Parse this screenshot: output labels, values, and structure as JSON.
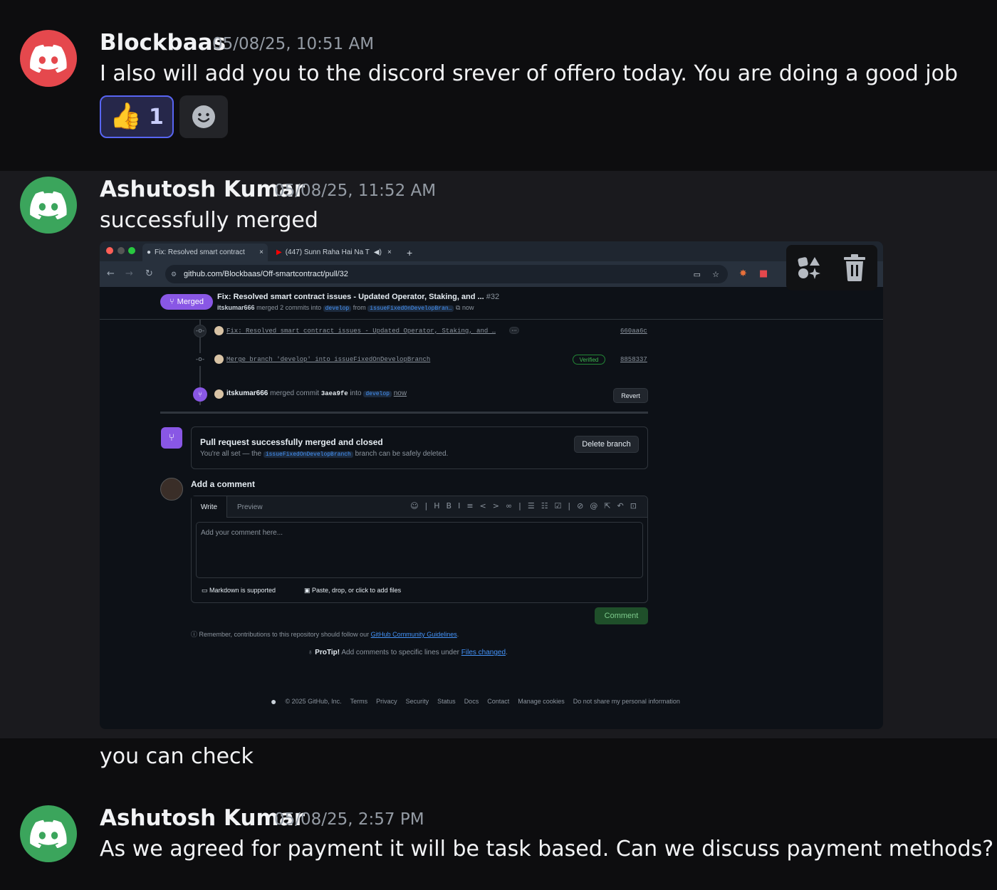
{
  "messages": [
    {
      "author": "Blockbaas",
      "timestamp": "05/08/25, 10:51 AM",
      "text": "I also will add you to the discord srever of offero today. You are doing a good job",
      "reactions": [
        {
          "emoji": "👍",
          "count": "1"
        }
      ]
    },
    {
      "author": "Ashutosh Kumar",
      "timestamp": "05/08/25, 11:52 AM",
      "text": "successfully merged",
      "followup": "you can check"
    },
    {
      "author": "Ashutosh Kumar",
      "timestamp": "05/08/25, 2:57 PM",
      "text": "As we agreed for payment it will be task based. Can we discuss payment methods?"
    }
  ],
  "avatar_colors": {
    "blockbaas": "#e5484d",
    "ashutosh": "#3ba55c"
  },
  "screenshot": {
    "tabs": [
      "Fix: Resolved smart contract",
      "(447) Sunn Raha Hai Na T"
    ],
    "url": "github.com/Blockbaas/Off-smartcontract/pull/32",
    "pr": {
      "status": "Merged",
      "title": "Fix: Resolved smart contract issues - Updated Operator, Staking, and ...",
      "number": "#32",
      "author": "itskumar666",
      "merged_text": "merged 2 commits into",
      "base": "develop",
      "from_text": "from",
      "head": "issueFixedOnDevelopBran…",
      "time": "now"
    },
    "commits": [
      {
        "message": "Fix: Resolved smart contract issues - Updated Operator, Staking, and …",
        "sha": "660aa6c",
        "more": "···"
      },
      {
        "message": "Merge branch 'develop' into issueFixedOnDevelopBranch",
        "sha": "8858337",
        "badge": "Verified"
      }
    ],
    "merge_event": {
      "user": "itskumar666",
      "text1": "merged commit",
      "commit": "3aea9fe",
      "text2": "into",
      "branch": "develop",
      "time": "now",
      "revert": "Revert"
    },
    "merge_box": {
      "title": "Pull request successfully merged and closed",
      "sub_prefix": "You're all set — the",
      "branch": "issueFixedOnDevelopBranch",
      "sub_suffix": "branch can be safely deleted.",
      "delete_button": "Delete branch"
    },
    "comment": {
      "heading": "Add a comment",
      "write_tab": "Write",
      "preview_tab": "Preview",
      "placeholder": "Add your comment here...",
      "markdown_note": "Markdown is supported",
      "attach_note": "Paste, drop, or click to add files",
      "button": "Comment"
    },
    "remember": {
      "text": "Remember, contributions to this repository should follow our",
      "link": "GitHub Community Guidelines",
      "end": "."
    },
    "protip": {
      "label": "ProTip!",
      "text": "Add comments to specific lines under",
      "link": "Files changed",
      "end": "."
    },
    "footer": [
      "© 2025 GitHub, Inc.",
      "Terms",
      "Privacy",
      "Security",
      "Status",
      "Docs",
      "Contact",
      "Manage cookies",
      "Do not share my personal information"
    ]
  }
}
